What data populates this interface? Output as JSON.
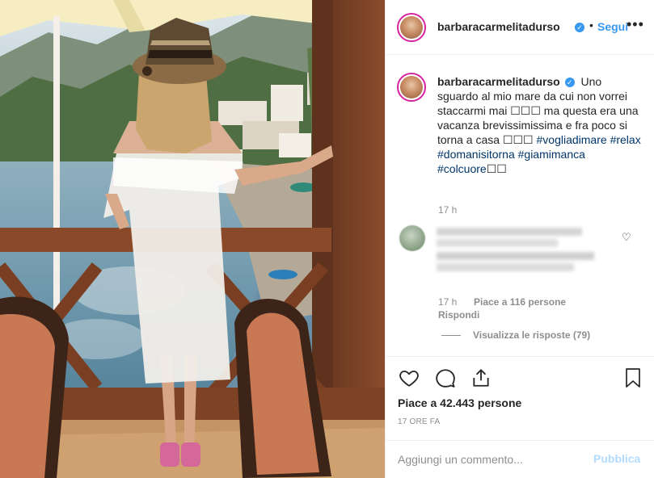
{
  "post": {
    "username": "barbaracarmelitadurso",
    "follow_label": "Segui",
    "more_label": "•••",
    "separator": "•",
    "verified_glyph": "✓"
  },
  "caption": {
    "username": "barbaracarmelitadurso",
    "text_1": "Uno sguardo al mio mare da cui non vorrei staccarmi mai",
    "emoji_1": "☐☐☐",
    "text_2": "ma questa era una vacanza brevissimissima e fra poco si torna a casa",
    "emoji_2": "☐☐☐",
    "hashtags": [
      "#vogliadimare",
      "#relax",
      "#domanisitorna",
      "#giamimanca",
      "#colcuore"
    ],
    "emoji_3": "☐☐",
    "time": "17 h"
  },
  "comment": {
    "time": "17 h",
    "likes": "Piace a 116 persone",
    "reply_label": "Rispondi",
    "view_replies": "Visualizza le risposte (79)"
  },
  "actions": {
    "likes_text": "Piace a 42.443 persone",
    "timestamp": "17 ORE FA",
    "comment_placeholder": "Aggiungi un commento...",
    "publish_label": "Pubblica"
  },
  "colors": {
    "link": "#3897f0",
    "hashtag": "#003569",
    "muted": "#8e8e8e",
    "border": "#efefef",
    "text": "#262626",
    "publish_disabled": "#b3dbff"
  },
  "icons": [
    "verified-badge-icon",
    "more-options-icon",
    "heart-icon",
    "comment-icon",
    "share-icon",
    "bookmark-icon"
  ]
}
